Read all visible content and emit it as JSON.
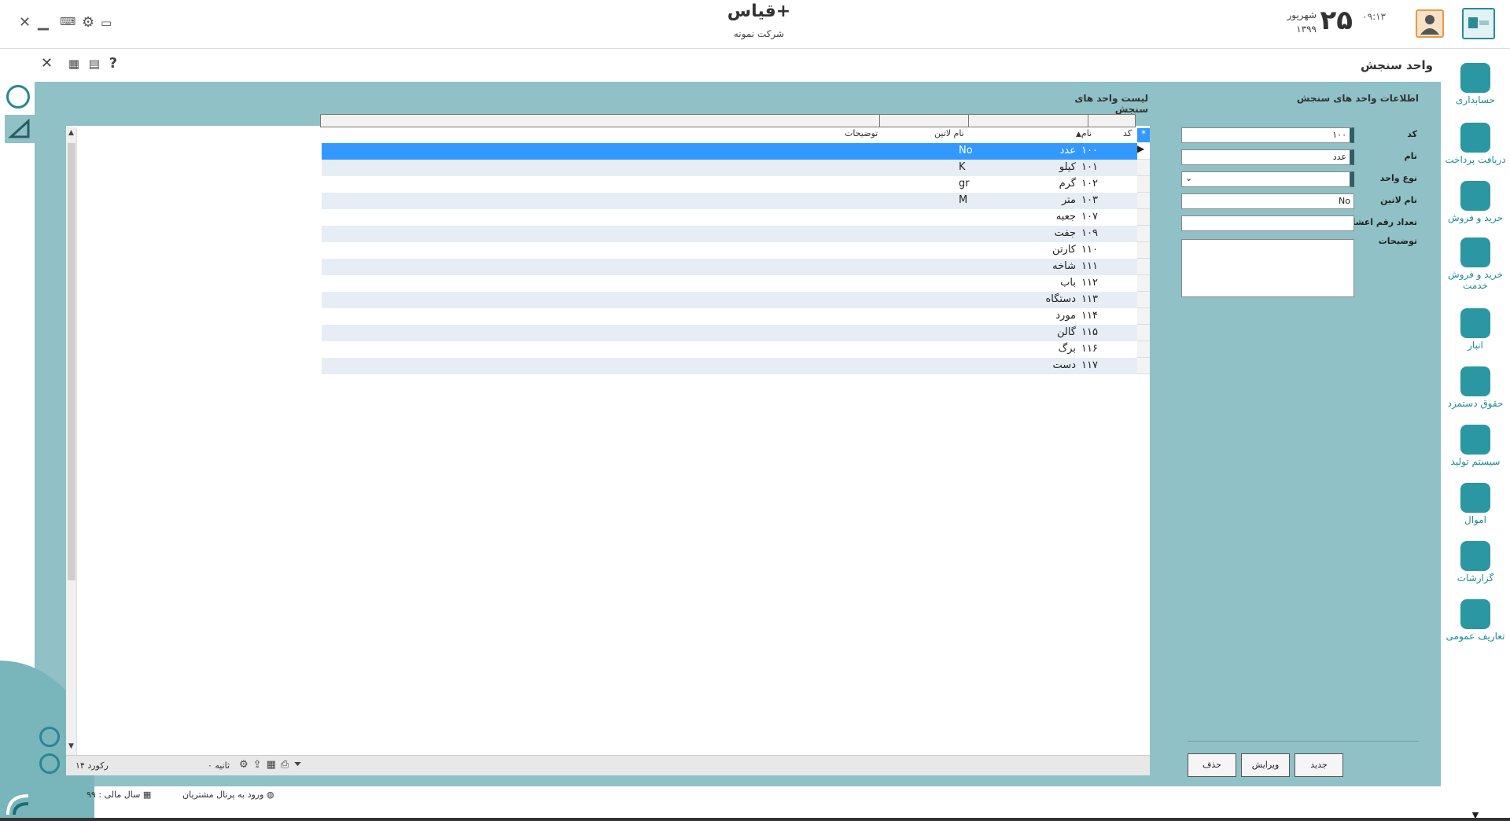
{
  "window": {
    "app_title": "قیاس+",
    "company": "شرکت نمونه",
    "time": "۰۹:۱۳",
    "day": "۲۵",
    "month": "شهریور",
    "year": "۱۳۹۹",
    "controls": [
      "close-icon",
      "minimize-icon",
      "keyboard-icon",
      "settings-icon",
      "monitor-icon"
    ]
  },
  "page": {
    "title": "واحد سنجش",
    "tools": [
      "close-icon",
      "grid-icon",
      "calendar-icon",
      "help-icon"
    ]
  },
  "sidebar": {
    "items": [
      {
        "label": "حسابداری",
        "icon": "accounting-icon"
      },
      {
        "label": "دریافت پرداخت",
        "icon": "payment-icon"
      },
      {
        "label": "خرید و فروش",
        "icon": "trade-icon"
      },
      {
        "label": "خرید و فروش خدمت",
        "icon": "service-icon"
      },
      {
        "label": "انبار",
        "icon": "warehouse-icon"
      },
      {
        "label": "حقوق دستمزد",
        "icon": "payroll-icon"
      },
      {
        "label": "سیستم تولید",
        "icon": "production-icon"
      },
      {
        "label": "اموال",
        "icon": "assets-icon"
      },
      {
        "label": "گزارشات",
        "icon": "reports-icon"
      },
      {
        "label": "تعاریف عمومی",
        "icon": "definitions-icon"
      }
    ]
  },
  "form": {
    "title": "اطلاعات واحد های سنجش",
    "code_label": "کد",
    "code_value": "۱۰۰",
    "name_label": "نام",
    "name_value": "عدد",
    "type_label": "نوع واحد",
    "latin_label": "نام لاتین",
    "latin_value": "No",
    "decimal_label": "تعداد رقم اعشار",
    "desc_label": "توضیحات",
    "buttons": {
      "new": "جدید",
      "edit": "ویرایش",
      "delete": "حذف"
    }
  },
  "list": {
    "title": "لیست واحد های سنجش",
    "columns": {
      "code": "کد",
      "name": "نام",
      "latin": "نام لاتین",
      "desc": "توضیحات"
    },
    "rows": [
      {
        "code": "۱۰۰",
        "name": "عدد",
        "latin": "No"
      },
      {
        "code": "۱۰۱",
        "name": "کیلو",
        "latin": "K"
      },
      {
        "code": "۱۰۲",
        "name": "گرم",
        "latin": "gr"
      },
      {
        "code": "۱۰۳",
        "name": "متر",
        "latin": "M"
      },
      {
        "code": "۱۰۷",
        "name": "جعبه",
        "latin": ""
      },
      {
        "code": "۱۰۹",
        "name": "جفت",
        "latin": ""
      },
      {
        "code": "۱۱۰",
        "name": "کارتن",
        "latin": ""
      },
      {
        "code": "۱۱۱",
        "name": "شاخه",
        "latin": ""
      },
      {
        "code": "۱۱۲",
        "name": "باب",
        "latin": ""
      },
      {
        "code": "۱۱۳",
        "name": "دستگاه",
        "latin": ""
      },
      {
        "code": "۱۱۴",
        "name": "مورد",
        "latin": ""
      },
      {
        "code": "۱۱۵",
        "name": "گالن",
        "latin": ""
      },
      {
        "code": "۱۱۶",
        "name": "برگ",
        "latin": ""
      },
      {
        "code": "۱۱۷",
        "name": "دست",
        "latin": ""
      }
    ],
    "selected_index": 0,
    "footer_records": "۱۴ رکورد",
    "footer_seconds": "۰ ثانیه"
  },
  "status": {
    "portal": "ورود به پرتال مشتریان",
    "fiscal_year": "سال مالی : ۹۹"
  },
  "colors": {
    "teal_bg": "#8fc1c6",
    "accent": "#2a97a3",
    "selection": "#3399ff"
  }
}
